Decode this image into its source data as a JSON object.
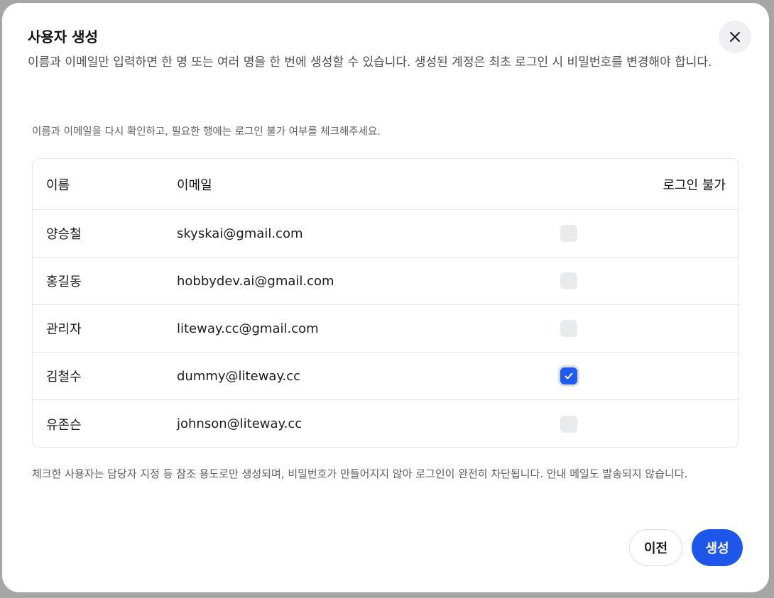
{
  "dialog": {
    "title": "사용자 생성",
    "description": "이름과 이메일만 입력하면 한 명 또는 여러 명을 한 번에 생성할 수 있습니다. 생성된 계정은 최초 로그인 시 비밀번호를 변경해야 합니다.",
    "hint": "이름과 이메일을 다시 확인하고, 필요한 행에는 로그인 불가 여부를 체크해주세요.",
    "footnote": "체크한 사용자는 담당자 지정 등 참조 용도로만 생성되며, 비밀번호가 만들어지지 않아 로그인이 완전히 차단됩니다. 안내 메일도 발송되지 않습니다.",
    "close_icon": "close-icon"
  },
  "table": {
    "headers": {
      "name": "이름",
      "email": "이메일",
      "login_blocked": "로그인 불가"
    },
    "rows": [
      {
        "name": "양승철",
        "email": "skyskai@gmail.com",
        "login_blocked": false
      },
      {
        "name": "홍길동",
        "email": "hobbydev.ai@gmail.com",
        "login_blocked": false
      },
      {
        "name": "관리자",
        "email": "liteway.cc@gmail.com",
        "login_blocked": false
      },
      {
        "name": "김철수",
        "email": "dummy@liteway.cc",
        "login_blocked": true
      },
      {
        "name": "유존슨",
        "email": "johnson@liteway.cc",
        "login_blocked": false
      }
    ]
  },
  "actions": {
    "prev_label": "이전",
    "create_label": "생성"
  },
  "colors": {
    "accent": "#1f56ea",
    "checkbox_checked": "#1f5bf0",
    "checkbox_unchecked": "#e9eaec"
  }
}
